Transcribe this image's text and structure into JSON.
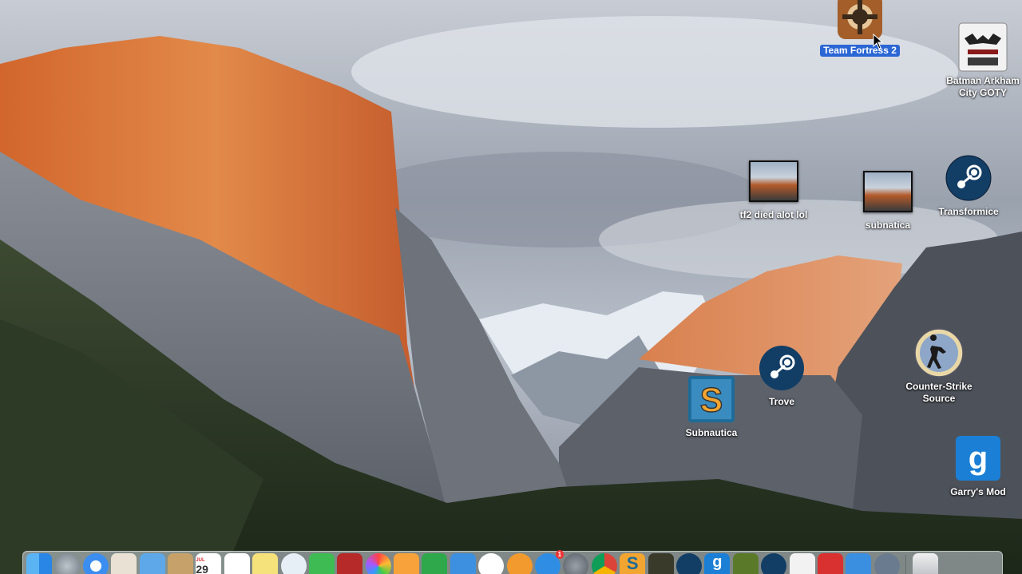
{
  "desktop_icons": {
    "team_fortress_2": {
      "label": "Team Fortress 2",
      "icon": "tf2-icon"
    },
    "batman": {
      "label": "Batman Arkham City GOTY",
      "icon": "batman-icon"
    },
    "tf2_video": {
      "label": "tf2 died alot lol",
      "icon": "video-thumbnail-icon"
    },
    "subnautica_video": {
      "label": "subnatica",
      "icon": "video-thumbnail-icon"
    },
    "transformice": {
      "label": "Transformice",
      "icon": "steam-icon"
    },
    "trove": {
      "label": "Trove",
      "icon": "steam-icon"
    },
    "subnautica": {
      "label": "Subnautica",
      "icon": "subnautica-icon"
    },
    "counter_strike": {
      "label": "Counter-Strike Source",
      "icon": "counter-strike-icon"
    },
    "garrys_mod": {
      "label": "Garry's Mod",
      "icon": "garrys-mod-icon"
    }
  },
  "dock": {
    "calendar_day": "29",
    "calendar_month": "JUL",
    "app_store_badge": "1",
    "items": [
      "Finder",
      "Launchpad",
      "Safari",
      "Contacts",
      "Mail",
      "Notes",
      "Calendar",
      "Reminders",
      "Stickies",
      "Messages",
      "FaceTime",
      "Photo Booth",
      "Photos",
      "Pages",
      "Numbers",
      "Keynote",
      "iTunes",
      "iBooks",
      "App Store",
      "System Preferences",
      "Chrome",
      "Subnautica",
      "Game",
      "Steam",
      "Garry's Mod",
      "Game",
      "Steam",
      "Batman",
      "Game",
      "Xcode",
      "Game",
      "Trash"
    ]
  }
}
